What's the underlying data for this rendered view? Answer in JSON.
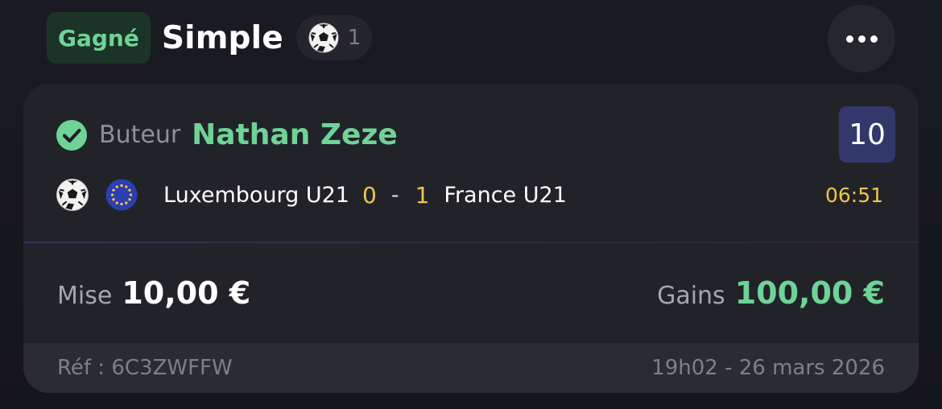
{
  "header": {
    "status": "Gagné",
    "bet_type": "Simple",
    "selection_count": "1",
    "sport_icon": "soccer-ball-icon",
    "more_icon": "more-horizontal-icon"
  },
  "selection": {
    "status_icon": "check-circle-icon",
    "market": "Buteur",
    "name": "Nathan Zeze",
    "odds": "10"
  },
  "match": {
    "sport_icon": "soccer-ball-icon",
    "competition_icon": "eu-flag-icon",
    "home_team": "Luxembourg U21",
    "home_score": "0",
    "separator": "-",
    "away_score": "1",
    "away_team": "France U21",
    "time": "06:51"
  },
  "stake": {
    "label": "Mise",
    "value": "10,00 €"
  },
  "gains": {
    "label": "Gains",
    "value": "100,00 €"
  },
  "footer": {
    "reference": "Réf : 6C3ZWFFW",
    "date": "19h02 - 26 mars 2026"
  },
  "colors": {
    "win_green": "#6fd397",
    "score_yellow": "#f0c64a",
    "odds_bg": "#33386b",
    "card_bg": "#222329"
  }
}
